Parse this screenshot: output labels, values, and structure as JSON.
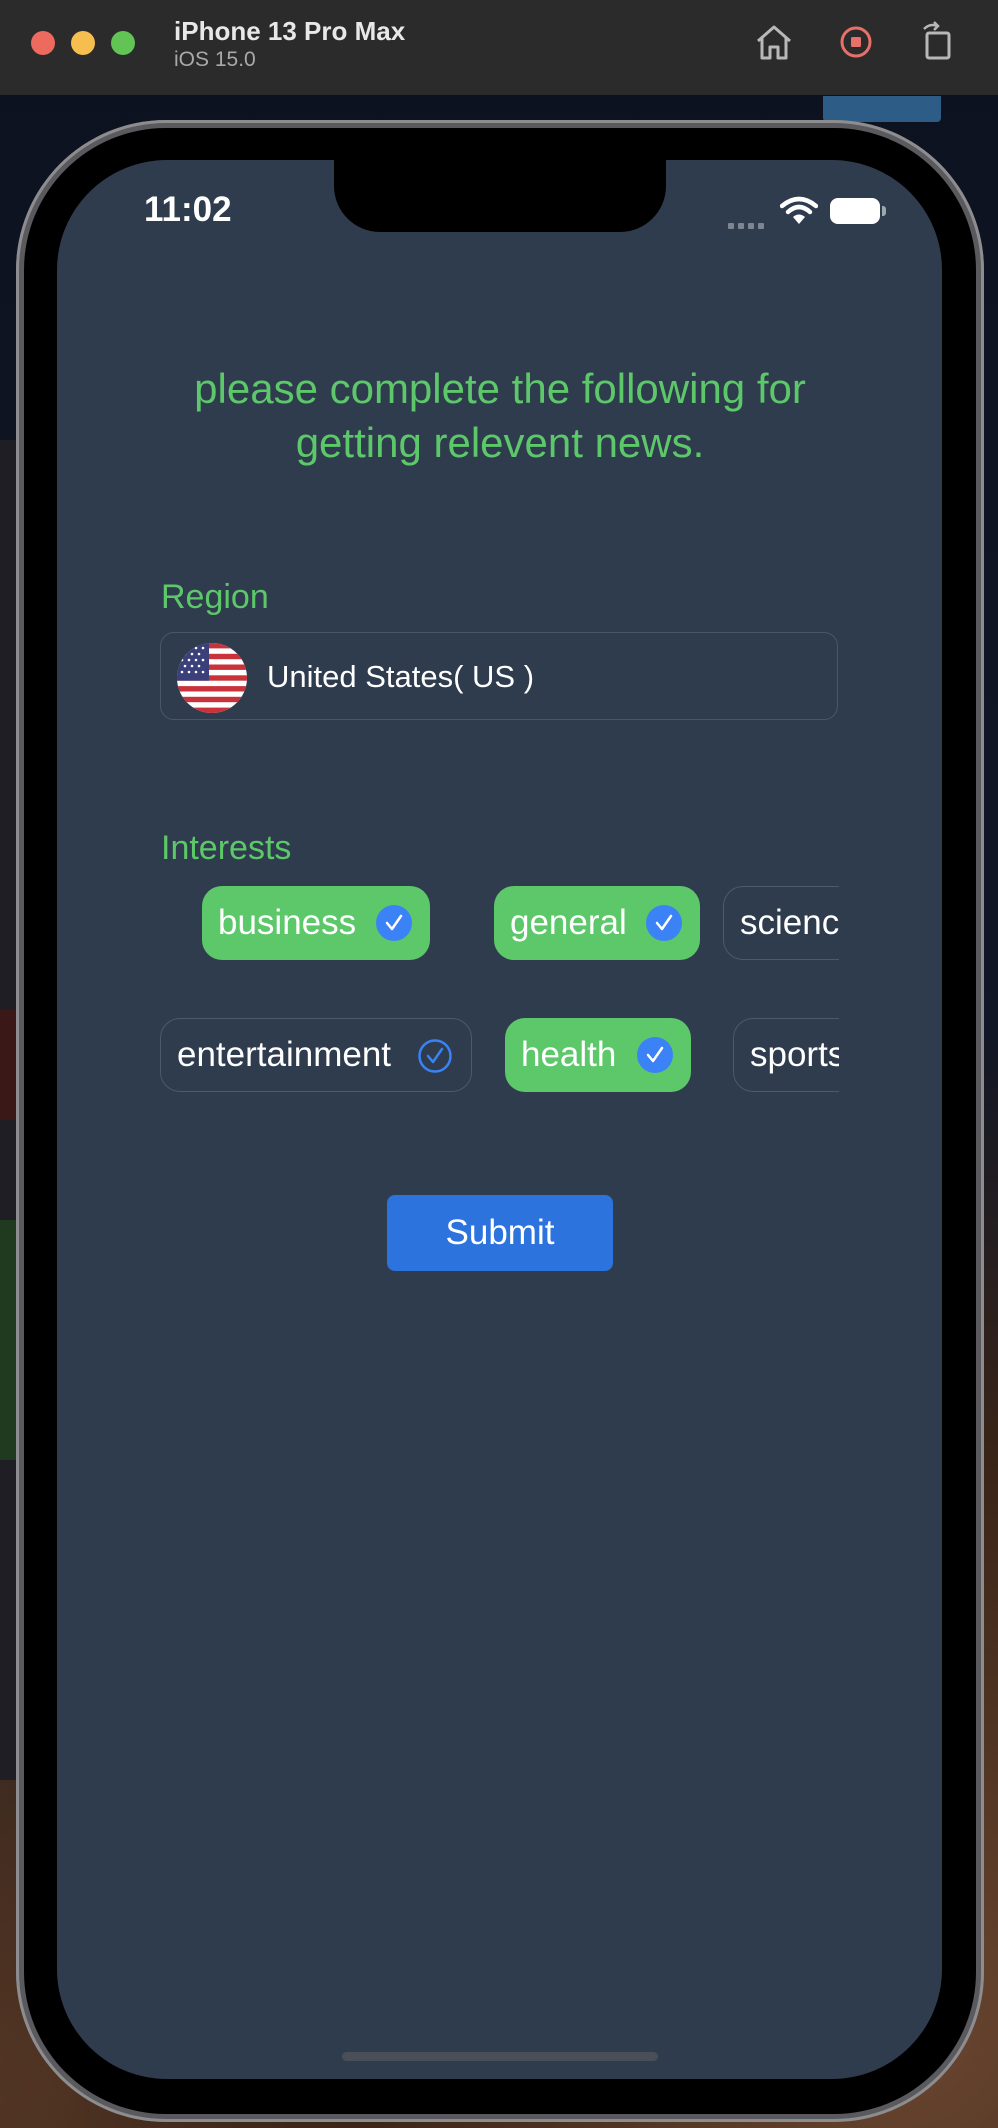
{
  "window": {
    "device_name": "iPhone 13 Pro Max",
    "os_version": "iOS 15.0",
    "icons": [
      "home-icon",
      "record-icon",
      "rotate-icon"
    ]
  },
  "status_bar": {
    "time": "11:02",
    "icons": [
      "signal-icon",
      "wifi-icon",
      "battery-icon"
    ]
  },
  "content": {
    "heading": "please complete the following for getting relevent news.",
    "region": {
      "label": "Region",
      "value": "United States( US )",
      "flag_icon": "us-flag-icon"
    },
    "interests": {
      "label": "Interests",
      "items": [
        {
          "label": "business",
          "selected": true
        },
        {
          "label": "general",
          "selected": true
        },
        {
          "label": "science",
          "selected": false
        },
        {
          "label": "entertainment",
          "selected": false
        },
        {
          "label": "health",
          "selected": true
        },
        {
          "label": "sports",
          "selected": false
        }
      ]
    },
    "submit_label": "Submit"
  },
  "colors": {
    "accent_green": "#5dc86a",
    "screen_background": "#2f3c4d",
    "button_blue": "#2d73de",
    "check_blue": "#3a82f6"
  }
}
